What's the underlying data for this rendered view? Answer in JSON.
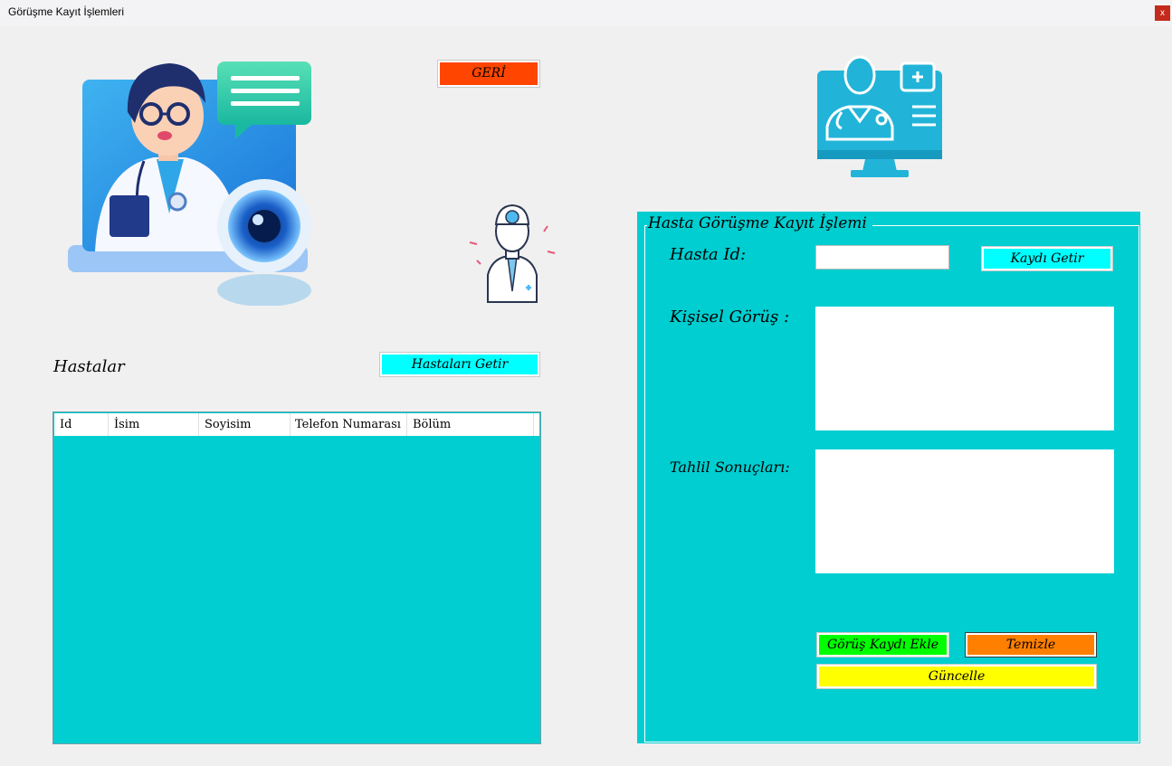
{
  "window": {
    "title": "Görüşme Kayıt İşlemleri",
    "close_label": "x"
  },
  "left": {
    "back_button": "GERİ",
    "patients_label": "Hastalar",
    "fetch_patients_button": "Hastaları Getir",
    "table": {
      "columns": [
        "Id",
        "İsim",
        "Soyisim",
        "Telefon Numarası",
        "Bölüm"
      ],
      "rows": []
    }
  },
  "panel": {
    "legend": "Hasta Görüşme Kayıt İşlemi",
    "patient_id_label": "Hasta Id:",
    "patient_id_value": "",
    "fetch_record_button": "Kaydı Getir",
    "personal_opinion_label": "Kişisel Görüş :",
    "personal_opinion_value": "",
    "analysis_results_label": "Tahlil Sonuçları:",
    "analysis_results_value": "",
    "add_button": "Görüş Kaydı Ekle",
    "clear_button": "Temizle",
    "update_button": "Güncelle"
  },
  "colors": {
    "panel_bg": "#00ced1",
    "back_button": "#ff4500",
    "cyan_button": "#00ffff",
    "add_button": "#00ff00",
    "clear_button": "#ff7f00",
    "update_button": "#ffff00"
  },
  "icons": [
    "doctor-video-call-illustration",
    "doctor-figure-icon",
    "doctor-monitor-icon"
  ]
}
